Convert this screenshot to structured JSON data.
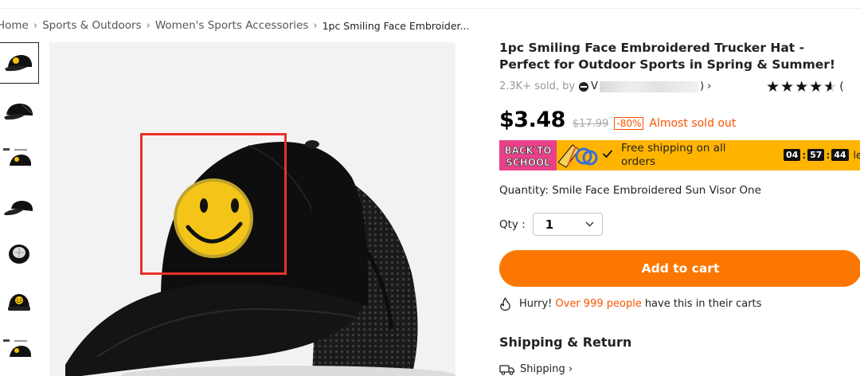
{
  "breadcrumb": {
    "items": [
      "Home",
      "Sports & Outdoors",
      "Women's Sports Accessories"
    ],
    "current": "1pc Smiling Face Embroider...",
    "separator": "›"
  },
  "gallery": {
    "thumbnail_count": 8,
    "active_index": 0,
    "main_image_subject": "black trucker hat with yellow smiley face patch",
    "highlight_color": "#e8312a"
  },
  "product": {
    "title": "1pc Smiling Face Embroidered Trucker Hat - Perfect for Outdoor Sports in Spring & Summer!",
    "sold_text": "2.3K+ sold, by",
    "store_initial": "V",
    "store_arrow": ")  ›",
    "rating_stars": "★★★★",
    "rating_half_star": "★",
    "rating_paren": "(",
    "price": "$3.48",
    "original_price": "$17.99",
    "discount": "-80%",
    "stock_status": "Almost sold out"
  },
  "promo": {
    "badge_line1": "BACK TO",
    "badge_line2": "SCHOOL",
    "free_shipping": "Free shipping on all orders",
    "timer_hours": "04",
    "timer_minutes": "57",
    "timer_seconds": "44",
    "timer_suffix": "left t",
    "bar_color": "#ffb400"
  },
  "quantity": {
    "option_text": "Quantity: Smile Face Embroidered Sun Visor One",
    "qty_label": "Qty :",
    "qty_value": "1"
  },
  "actions": {
    "add_to_cart": "Add to cart",
    "accent_color": "#fb7701"
  },
  "hurry": {
    "prefix": "Hurry!",
    "highlight": "Over 999 people",
    "suffix": "have this in their carts"
  },
  "shipping": {
    "section_title": "Shipping & Return",
    "link_label": "Shipping ›"
  }
}
